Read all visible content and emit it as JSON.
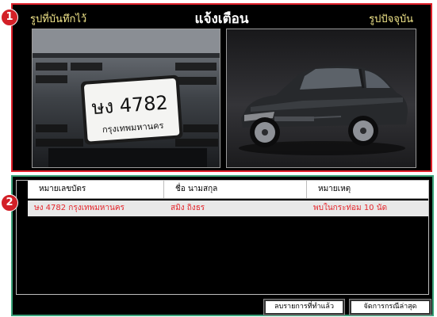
{
  "alert": {
    "title": "แจ้งเตือน",
    "left_label": "รูปที่บันทึกไว้",
    "right_label": "รูปปัจจุบัน",
    "plate_number": "ษง 4782",
    "plate_province": "กรุงเทพมหานคร"
  },
  "markers": {
    "one": "1",
    "two": "2"
  },
  "table": {
    "headers": [
      "หมายเลขบัตร",
      "ชื่อ นามสกุล",
      "หมายเหตุ"
    ],
    "rows": [
      {
        "card": "ษง 4782 กรุงเทพมหานคร",
        "name": "สมิง ถิงธร",
        "note": "พบในกระท่อม 10 นัด"
      }
    ]
  },
  "buttons": {
    "clear": "ลบรายการที่ทำแล้ว",
    "handle": "จัดการกรณีล่าสุด"
  },
  "colors": {
    "alert_border": "#e0202a",
    "list_border": "#3aa37a",
    "highlight_text": "#e5262c",
    "label_text": "#f2e68a"
  }
}
